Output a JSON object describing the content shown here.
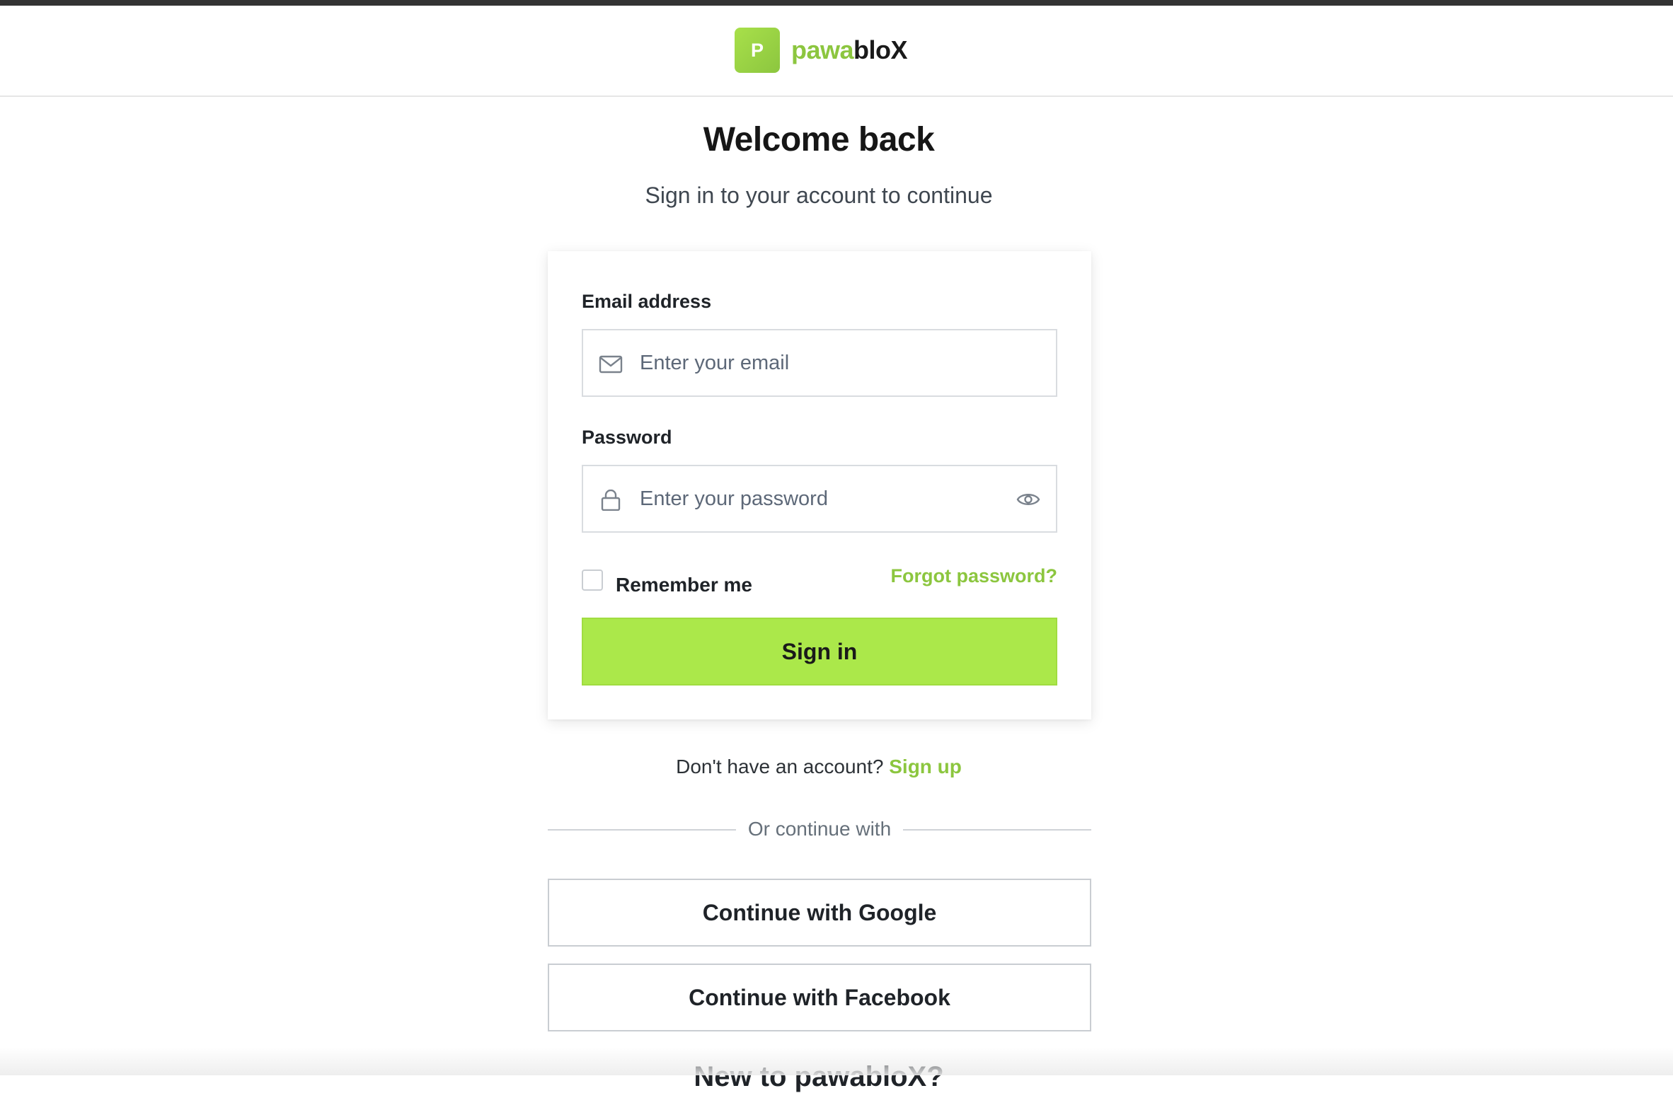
{
  "brand": {
    "logo_letter": "P",
    "name_part1": "pawa",
    "name_part2": "bloX",
    "accent_color": "#8cc63f"
  },
  "heading": {
    "title": "Welcome back",
    "subtitle": "Sign in to your account to continue"
  },
  "form": {
    "email": {
      "label": "Email address",
      "placeholder": "Enter your email",
      "value": "",
      "icon": "mail-icon"
    },
    "password": {
      "label": "Password",
      "placeholder": "Enter your password",
      "value": "",
      "icon": "lock-icon",
      "toggle_icon": "eye-icon"
    },
    "remember_label": "Remember me",
    "remember_checked": false,
    "forgot_label": "Forgot password?",
    "submit_label": "Sign in",
    "submit_color": "#abe84a"
  },
  "signup": {
    "prompt": "Don't have an account?",
    "link_label": "Sign up"
  },
  "divider_text": "Or continue with",
  "social": {
    "google_label": "Continue with Google",
    "facebook_label": "Continue with Facebook"
  },
  "cut_off_text": "New to pawabloX?"
}
